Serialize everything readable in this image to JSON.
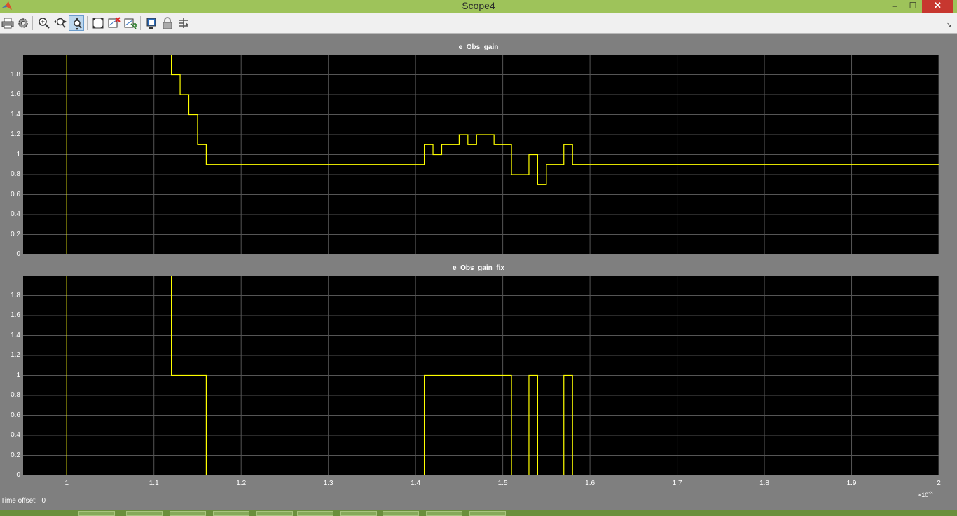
{
  "window": {
    "title": "Scope4",
    "controls": {
      "minimize": "–",
      "maximize": "☐",
      "close": "✕"
    }
  },
  "toolbar": {
    "buttons": [
      {
        "name": "print-icon",
        "active": false
      },
      {
        "name": "settings-icon",
        "active": false
      },
      {
        "name": "zoom-in-icon",
        "active": false
      },
      {
        "name": "zoom-x-icon",
        "active": false
      },
      {
        "name": "zoom-y-icon",
        "active": true
      },
      {
        "name": "autoscale-icon",
        "active": false
      },
      {
        "name": "save-axes-settings-icon",
        "active": false
      },
      {
        "name": "restore-axes-settings-icon",
        "active": false
      },
      {
        "name": "floating-scope-icon",
        "active": false
      },
      {
        "name": "lock-axes-icon",
        "active": false
      },
      {
        "name": "signal-selection-icon",
        "active": false
      }
    ],
    "dock_arrow": "↘"
  },
  "colors": {
    "titlebar": "#9ec35a",
    "plot_background": "#000000",
    "trace": "#ffff00",
    "grid": "#555555",
    "figure_background": "#7f7f7f"
  },
  "chart_data": [
    {
      "type": "line",
      "title": "e_Obs_gain",
      "step": true,
      "xlim": [
        0.95,
        2.0
      ],
      "ylim": [
        0,
        2.0
      ],
      "x_ticks": [
        "1",
        "1.1",
        "1.2",
        "1.3",
        "1.4",
        "1.5",
        "1.6",
        "1.7",
        "1.8",
        "1.9",
        "2"
      ],
      "y_ticks": [
        "0",
        "0.2",
        "0.4",
        "0.6",
        "0.8",
        "1",
        "1.2",
        "1.4",
        "1.6",
        "1.8"
      ],
      "grid": true,
      "series": [
        {
          "color": "#ffff00",
          "x": [
            0.95,
            1.0,
            1.0,
            1.12,
            1.13,
            1.14,
            1.15,
            1.16,
            1.41,
            1.42,
            1.43,
            1.45,
            1.46,
            1.47,
            1.49,
            1.51,
            1.53,
            1.54,
            1.55,
            1.57,
            1.58,
            2.0
          ],
          "y": [
            0,
            0,
            2.0,
            1.8,
            1.6,
            1.4,
            1.1,
            0.9,
            1.1,
            1.0,
            1.1,
            1.2,
            1.1,
            1.2,
            1.1,
            0.8,
            1.0,
            0.7,
            0.9,
            1.1,
            0.9,
            0.9
          ]
        }
      ]
    },
    {
      "type": "line",
      "title": "e_Obs_gain_fix",
      "step": true,
      "xlim": [
        0.95,
        2.0
      ],
      "ylim": [
        0,
        2.0
      ],
      "x_ticks": [
        "1",
        "1.1",
        "1.2",
        "1.3",
        "1.4",
        "1.5",
        "1.6",
        "1.7",
        "1.8",
        "1.9",
        "2"
      ],
      "y_ticks": [
        "0",
        "0.2",
        "0.4",
        "0.6",
        "0.8",
        "1",
        "1.2",
        "1.4",
        "1.6",
        "1.8"
      ],
      "grid": true,
      "x_exponent": "×10⁻³",
      "series": [
        {
          "color": "#ffff00",
          "x": [
            0.95,
            1.0,
            1.0,
            1.12,
            1.16,
            1.41,
            1.51,
            1.53,
            1.54,
            1.57,
            1.58,
            2.0
          ],
          "y": [
            0,
            0,
            2.0,
            1.0,
            0,
            1.0,
            0,
            1.0,
            0,
            1.0,
            0,
            0
          ]
        }
      ]
    }
  ],
  "status": {
    "time_offset_label": "Time offset:",
    "time_offset_value": "0"
  },
  "x_exponent": {
    "base": "×10",
    "power": "-3"
  }
}
